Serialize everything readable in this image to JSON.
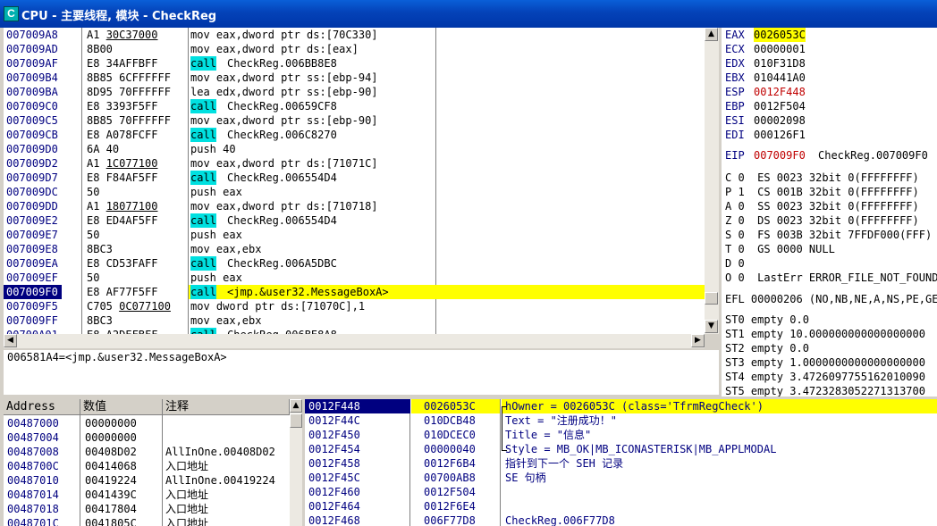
{
  "window": {
    "title": "CPU - 主要线程, 模块 - CheckReg",
    "icon_letter": "C"
  },
  "disasm": {
    "rows": [
      {
        "addr": "007009A8",
        "hex": "A1 ",
        "hex2": "30C37000",
        "hex2_ul": true,
        "asm": "mov eax,dword ptr ds:[70C330]"
      },
      {
        "addr": "007009AD",
        "hex": "8B00",
        "asm": "mov eax,dword ptr ds:[eax]"
      },
      {
        "addr": "007009AF",
        "hex": "E8 34AFFBFF",
        "call": true,
        "asm": "CheckReg.006BB8E8"
      },
      {
        "addr": "007009B4",
        "hex": "8B85 6CFFFFFF",
        "asm": "mov eax,dword ptr ss:[ebp-94]"
      },
      {
        "addr": "007009BA",
        "hex": "8D95 70FFFFFF",
        "asm": "lea edx,dword ptr ss:[ebp-90]"
      },
      {
        "addr": "007009C0",
        "hex": "E8 3393F5FF",
        "call": true,
        "asm": "CheckReg.00659CF8"
      },
      {
        "addr": "007009C5",
        "hex": "8B85 70FFFFFF",
        "asm": "mov eax,dword ptr ss:[ebp-90]"
      },
      {
        "addr": "007009CB",
        "hex": "E8 A078FCFF",
        "call": true,
        "asm": "CheckReg.006C8270"
      },
      {
        "addr": "007009D0",
        "hex": "6A 40",
        "asm": "push 40"
      },
      {
        "addr": "007009D2",
        "hex": "A1 ",
        "hex2": "1C077100",
        "hex2_ul": true,
        "asm": "mov eax,dword ptr ds:[71071C]"
      },
      {
        "addr": "007009D7",
        "hex": "E8 F84AF5FF",
        "call": true,
        "asm": "CheckReg.006554D4"
      },
      {
        "addr": "007009DC",
        "hex": "50",
        "asm": "push eax"
      },
      {
        "addr": "007009DD",
        "hex": "A1 ",
        "hex2": "18077100",
        "hex2_ul": true,
        "asm": "mov eax,dword ptr ds:[710718]"
      },
      {
        "addr": "007009E2",
        "hex": "E8 ED4AF5FF",
        "call": true,
        "asm": "CheckReg.006554D4"
      },
      {
        "addr": "007009E7",
        "hex": "50",
        "asm": "push eax"
      },
      {
        "addr": "007009E8",
        "hex": "8BC3",
        "asm": "mov eax,ebx"
      },
      {
        "addr": "007009EA",
        "hex": "E8 CD53FAFF",
        "call": true,
        "asm": "CheckReg.006A5DBC"
      },
      {
        "addr": "007009EF",
        "hex": "50",
        "asm": "push eax"
      },
      {
        "addr": "007009F0",
        "hex": "E8 AF77F5FF",
        "call": true,
        "selected": true,
        "asm": "<jmp.&user32.MessageBoxA>"
      },
      {
        "addr": "007009F5",
        "hex": "C705 ",
        "hex2": "0C077100",
        "hex2_ul": true,
        "asm": "mov dword ptr ds:[71070C],1"
      },
      {
        "addr": "007009FF",
        "hex": "8BC3",
        "asm": "mov eax,ebx"
      },
      {
        "addr": "00700A01",
        "hex": "E8 A2DEFBFF",
        "call": true,
        "asm": "CheckReg.006BE8A8"
      }
    ],
    "call_keyword": "call"
  },
  "info_line": "006581A4=<jmp.&user32.MessageBoxA>",
  "registers": {
    "gp": [
      {
        "name": "EAX",
        "value": "0026053C",
        "highlight": true
      },
      {
        "name": "ECX",
        "value": "00000001"
      },
      {
        "name": "EDX",
        "value": "010F31D8"
      },
      {
        "name": "EBX",
        "value": "010441A0"
      },
      {
        "name": "ESP",
        "value": "0012F448",
        "red": true
      },
      {
        "name": "EBP",
        "value": "0012F504"
      },
      {
        "name": "ESI",
        "value": "00002098"
      },
      {
        "name": "EDI",
        "value": "000126F1"
      }
    ],
    "eip": {
      "name": "EIP",
      "value": "007009F0",
      "comment": "CheckReg.007009F0"
    },
    "flags": [
      "C 0  ES 0023 32bit 0(FFFFFFFF)",
      "P 1  CS 001B 32bit 0(FFFFFFFF)",
      "A 0  SS 0023 32bit 0(FFFFFFFF)",
      "Z 0  DS 0023 32bit 0(FFFFFFFF)",
      "S 0  FS 003B 32bit 7FFDF000(FFF)",
      "T 0  GS 0000 NULL",
      "D 0",
      "O 0  LastErr ERROR_FILE_NOT_FOUND"
    ],
    "efl": "EFL 00000206 (NO,NB,NE,A,NS,PE,GE,G)",
    "fpu": [
      "ST0 empty 0.0",
      "ST1 empty 10.000000000000000000",
      "ST2 empty 0.0",
      "ST3 empty 1.0000000000000000000",
      "ST4 empty 3.4726097755162010090",
      "ST5 empty 3.4723283052271313700"
    ]
  },
  "dump": {
    "headers": [
      "Address",
      "数值",
      "注释"
    ],
    "rows": [
      {
        "addr": "00487000",
        "val": "00000000",
        "note": ""
      },
      {
        "addr": "00487004",
        "val": "00000000",
        "note": ""
      },
      {
        "addr": "00487008",
        "val": "00408D02",
        "note": "AllInOne.00408D02"
      },
      {
        "addr": "0048700C",
        "val": "00414068",
        "note": "入口地址"
      },
      {
        "addr": "00487010",
        "val": "00419224",
        "note": "AllInOne.00419224"
      },
      {
        "addr": "00487014",
        "val": "0041439C",
        "note": "入口地址"
      },
      {
        "addr": "00487018",
        "val": "00417804",
        "note": "入口地址"
      },
      {
        "addr": "0048701C",
        "val": "0041805C",
        "note": "入口地址"
      }
    ]
  },
  "stack": {
    "rows": [
      {
        "addr": "0012F448",
        "val": "0026053C",
        "note": "hOwner = 0026053C (class='TfrmRegCheck')",
        "selected": true
      },
      {
        "addr": "0012F44C",
        "val": "010DCB48",
        "note": "Text = \"注册成功！\""
      },
      {
        "addr": "0012F450",
        "val": "010DCEC0",
        "note": "Title = \"信息\""
      },
      {
        "addr": "0012F454",
        "val": "00000040",
        "note": "Style = MB_OK|MB_ICONASTERISK|MB_APPLMODAL"
      },
      {
        "addr": "0012F458",
        "val": "0012F6B4",
        "note": "指针到下一个 SEH 记录"
      },
      {
        "addr": "0012F45C",
        "val": "00700AB8",
        "note": "SE 句柄"
      },
      {
        "addr": "0012F460",
        "val": "0012F504",
        "note": ""
      },
      {
        "addr": "0012F464",
        "val": "0012F6E4",
        "note": ""
      },
      {
        "addr": "0012F468",
        "val": "006F77D8",
        "note": "CheckReg.006F77D8"
      }
    ]
  }
}
